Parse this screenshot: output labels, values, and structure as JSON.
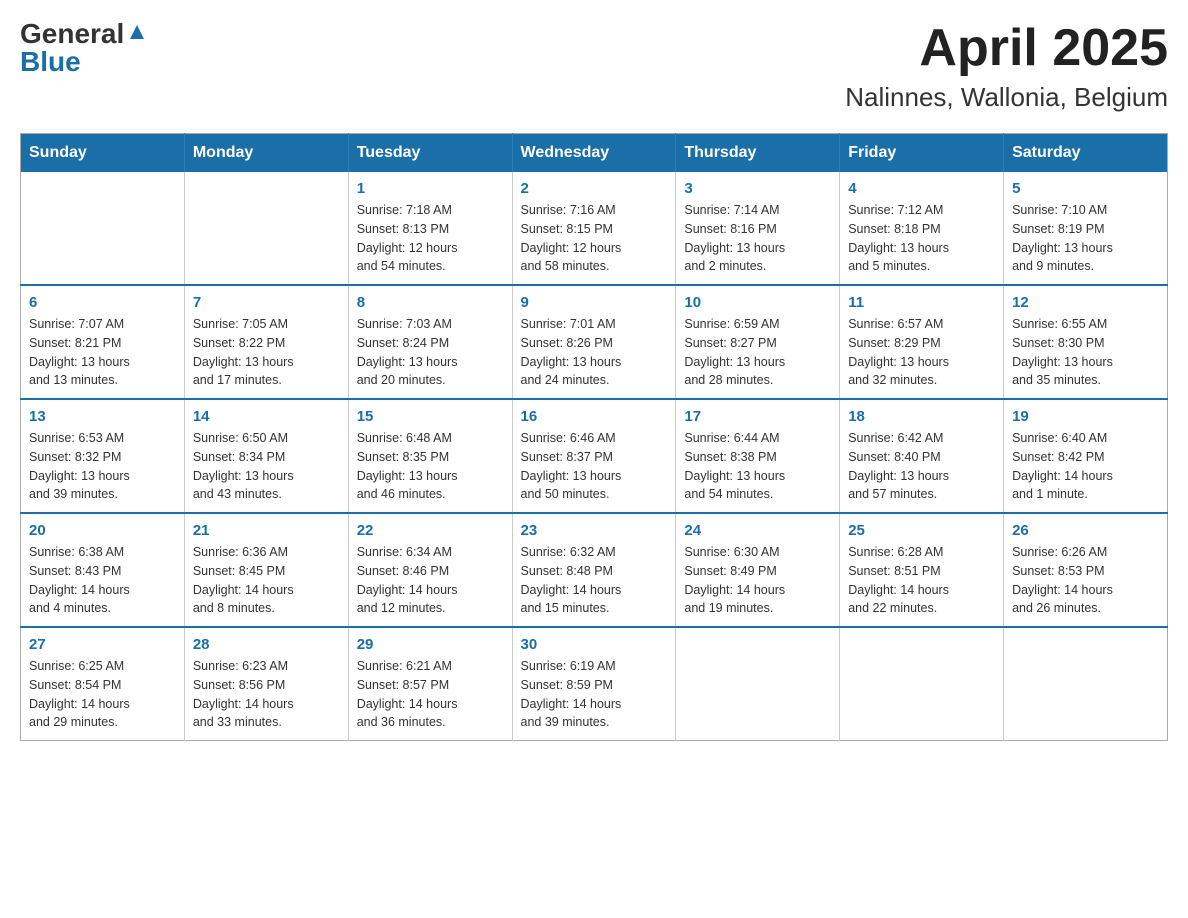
{
  "logo": {
    "general": "General",
    "blue": "Blue"
  },
  "title": "April 2025",
  "location": "Nalinnes, Wallonia, Belgium",
  "weekdays": [
    "Sunday",
    "Monday",
    "Tuesday",
    "Wednesday",
    "Thursday",
    "Friday",
    "Saturday"
  ],
  "weeks": [
    [
      {
        "day": "",
        "info": ""
      },
      {
        "day": "",
        "info": ""
      },
      {
        "day": "1",
        "info": "Sunrise: 7:18 AM\nSunset: 8:13 PM\nDaylight: 12 hours\nand 54 minutes."
      },
      {
        "day": "2",
        "info": "Sunrise: 7:16 AM\nSunset: 8:15 PM\nDaylight: 12 hours\nand 58 minutes."
      },
      {
        "day": "3",
        "info": "Sunrise: 7:14 AM\nSunset: 8:16 PM\nDaylight: 13 hours\nand 2 minutes."
      },
      {
        "day": "4",
        "info": "Sunrise: 7:12 AM\nSunset: 8:18 PM\nDaylight: 13 hours\nand 5 minutes."
      },
      {
        "day": "5",
        "info": "Sunrise: 7:10 AM\nSunset: 8:19 PM\nDaylight: 13 hours\nand 9 minutes."
      }
    ],
    [
      {
        "day": "6",
        "info": "Sunrise: 7:07 AM\nSunset: 8:21 PM\nDaylight: 13 hours\nand 13 minutes."
      },
      {
        "day": "7",
        "info": "Sunrise: 7:05 AM\nSunset: 8:22 PM\nDaylight: 13 hours\nand 17 minutes."
      },
      {
        "day": "8",
        "info": "Sunrise: 7:03 AM\nSunset: 8:24 PM\nDaylight: 13 hours\nand 20 minutes."
      },
      {
        "day": "9",
        "info": "Sunrise: 7:01 AM\nSunset: 8:26 PM\nDaylight: 13 hours\nand 24 minutes."
      },
      {
        "day": "10",
        "info": "Sunrise: 6:59 AM\nSunset: 8:27 PM\nDaylight: 13 hours\nand 28 minutes."
      },
      {
        "day": "11",
        "info": "Sunrise: 6:57 AM\nSunset: 8:29 PM\nDaylight: 13 hours\nand 32 minutes."
      },
      {
        "day": "12",
        "info": "Sunrise: 6:55 AM\nSunset: 8:30 PM\nDaylight: 13 hours\nand 35 minutes."
      }
    ],
    [
      {
        "day": "13",
        "info": "Sunrise: 6:53 AM\nSunset: 8:32 PM\nDaylight: 13 hours\nand 39 minutes."
      },
      {
        "day": "14",
        "info": "Sunrise: 6:50 AM\nSunset: 8:34 PM\nDaylight: 13 hours\nand 43 minutes."
      },
      {
        "day": "15",
        "info": "Sunrise: 6:48 AM\nSunset: 8:35 PM\nDaylight: 13 hours\nand 46 minutes."
      },
      {
        "day": "16",
        "info": "Sunrise: 6:46 AM\nSunset: 8:37 PM\nDaylight: 13 hours\nand 50 minutes."
      },
      {
        "day": "17",
        "info": "Sunrise: 6:44 AM\nSunset: 8:38 PM\nDaylight: 13 hours\nand 54 minutes."
      },
      {
        "day": "18",
        "info": "Sunrise: 6:42 AM\nSunset: 8:40 PM\nDaylight: 13 hours\nand 57 minutes."
      },
      {
        "day": "19",
        "info": "Sunrise: 6:40 AM\nSunset: 8:42 PM\nDaylight: 14 hours\nand 1 minute."
      }
    ],
    [
      {
        "day": "20",
        "info": "Sunrise: 6:38 AM\nSunset: 8:43 PM\nDaylight: 14 hours\nand 4 minutes."
      },
      {
        "day": "21",
        "info": "Sunrise: 6:36 AM\nSunset: 8:45 PM\nDaylight: 14 hours\nand 8 minutes."
      },
      {
        "day": "22",
        "info": "Sunrise: 6:34 AM\nSunset: 8:46 PM\nDaylight: 14 hours\nand 12 minutes."
      },
      {
        "day": "23",
        "info": "Sunrise: 6:32 AM\nSunset: 8:48 PM\nDaylight: 14 hours\nand 15 minutes."
      },
      {
        "day": "24",
        "info": "Sunrise: 6:30 AM\nSunset: 8:49 PM\nDaylight: 14 hours\nand 19 minutes."
      },
      {
        "day": "25",
        "info": "Sunrise: 6:28 AM\nSunset: 8:51 PM\nDaylight: 14 hours\nand 22 minutes."
      },
      {
        "day": "26",
        "info": "Sunrise: 6:26 AM\nSunset: 8:53 PM\nDaylight: 14 hours\nand 26 minutes."
      }
    ],
    [
      {
        "day": "27",
        "info": "Sunrise: 6:25 AM\nSunset: 8:54 PM\nDaylight: 14 hours\nand 29 minutes."
      },
      {
        "day": "28",
        "info": "Sunrise: 6:23 AM\nSunset: 8:56 PM\nDaylight: 14 hours\nand 33 minutes."
      },
      {
        "day": "29",
        "info": "Sunrise: 6:21 AM\nSunset: 8:57 PM\nDaylight: 14 hours\nand 36 minutes."
      },
      {
        "day": "30",
        "info": "Sunrise: 6:19 AM\nSunset: 8:59 PM\nDaylight: 14 hours\nand 39 minutes."
      },
      {
        "day": "",
        "info": ""
      },
      {
        "day": "",
        "info": ""
      },
      {
        "day": "",
        "info": ""
      }
    ]
  ]
}
